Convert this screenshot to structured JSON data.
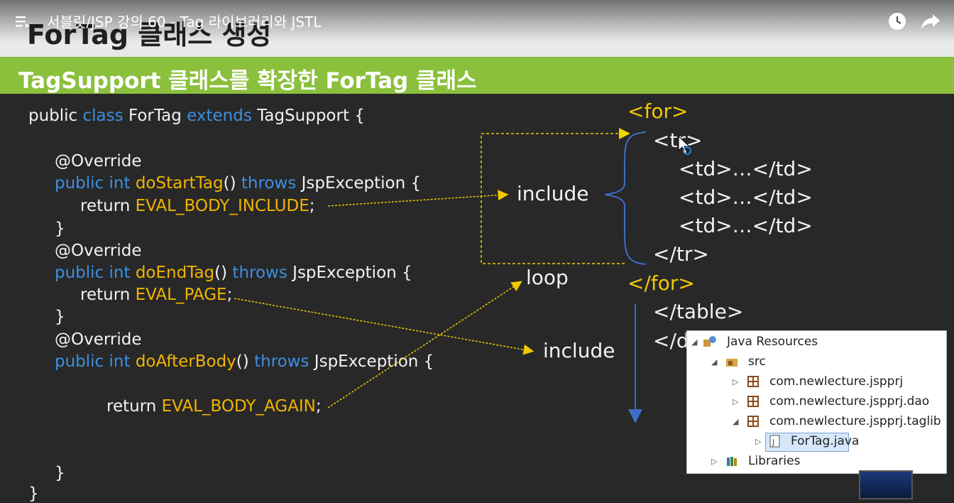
{
  "player": {
    "video_title": "서블릿/JSP 강의 60 - Tag 라이브러리와 JSTL",
    "icons": [
      "menu-icon",
      "clock-icon",
      "share-icon"
    ]
  },
  "slide": {
    "title": "ForTag 클래스 생성",
    "subtitle": "TagSupport 클래스를 확장한 ForTag 클래스"
  },
  "code": {
    "l1_public": "public",
    "l1_class": "class",
    "l1_name": "ForTag",
    "l1_extends": "extends",
    "l1_rest": "TagSupport {",
    "override1": "@Override",
    "m1_public": "public",
    "m1_int": "int",
    "m1_name": "doStartTag",
    "m1_paren": "()",
    "m1_throws": "throws",
    "m1_exc": "JspException {",
    "m1_return": "return",
    "m1_value": "EVAL_BODY_INCLUDE",
    "m1_semi": ";",
    "m1_close": "}",
    "override2": "@Override",
    "m2_public": "public",
    "m2_int": "int",
    "m2_name": "doEndTag",
    "m2_paren": "()",
    "m2_throws": "throws",
    "m2_exc": "JspException {",
    "m2_return": "return",
    "m2_value": "EVAL_PAGE",
    "m2_semi": ";",
    "m2_close": "}",
    "override3": "@Override",
    "m3_public": "public",
    "m3_int": "int",
    "m3_name": "doAfterBody",
    "m3_paren": "()",
    "m3_throws": "throws",
    "m3_exc": "JspException {",
    "m3_return": "return",
    "m3_value": "EVAL_BODY_AGAIN",
    "m3_semi": ";",
    "m3_close": "}",
    "class_close": "}"
  },
  "diagram": {
    "for_open": "<for>",
    "tr_open": "<tr>",
    "td1": "<td>…</td>",
    "td2": "<td>…</td>",
    "td3": "<td>…</td>",
    "tr_close": "</tr>",
    "for_close": "</for>",
    "table_close": "</table>",
    "div_close_partial": "</d",
    "include1": "include",
    "loop": "loop",
    "include2": "include"
  },
  "eclipse_tree": {
    "items": [
      {
        "label": "Java Resources",
        "icon": "java-resources-icon",
        "expanded": true
      },
      {
        "label": "src",
        "icon": "source-folder-icon",
        "expanded": true
      },
      {
        "label": "com.newlecture.jspprj",
        "icon": "package-icon",
        "expanded": false
      },
      {
        "label": "com.newlecture.jspprj.dao",
        "icon": "package-icon",
        "expanded": false
      },
      {
        "label": "com.newlecture.jspprj.taglib",
        "icon": "package-icon",
        "expanded": true
      },
      {
        "label": "ForTag.java",
        "icon": "java-file-icon",
        "expanded": false,
        "selected": true
      },
      {
        "label": "Libraries",
        "icon": "libraries-icon",
        "expanded": false
      }
    ]
  },
  "colors": {
    "keyword": "#3c8fe0",
    "method": "#f0b400",
    "tag": "#f0c800",
    "green_band": "#8ac03c",
    "background": "#282828"
  }
}
